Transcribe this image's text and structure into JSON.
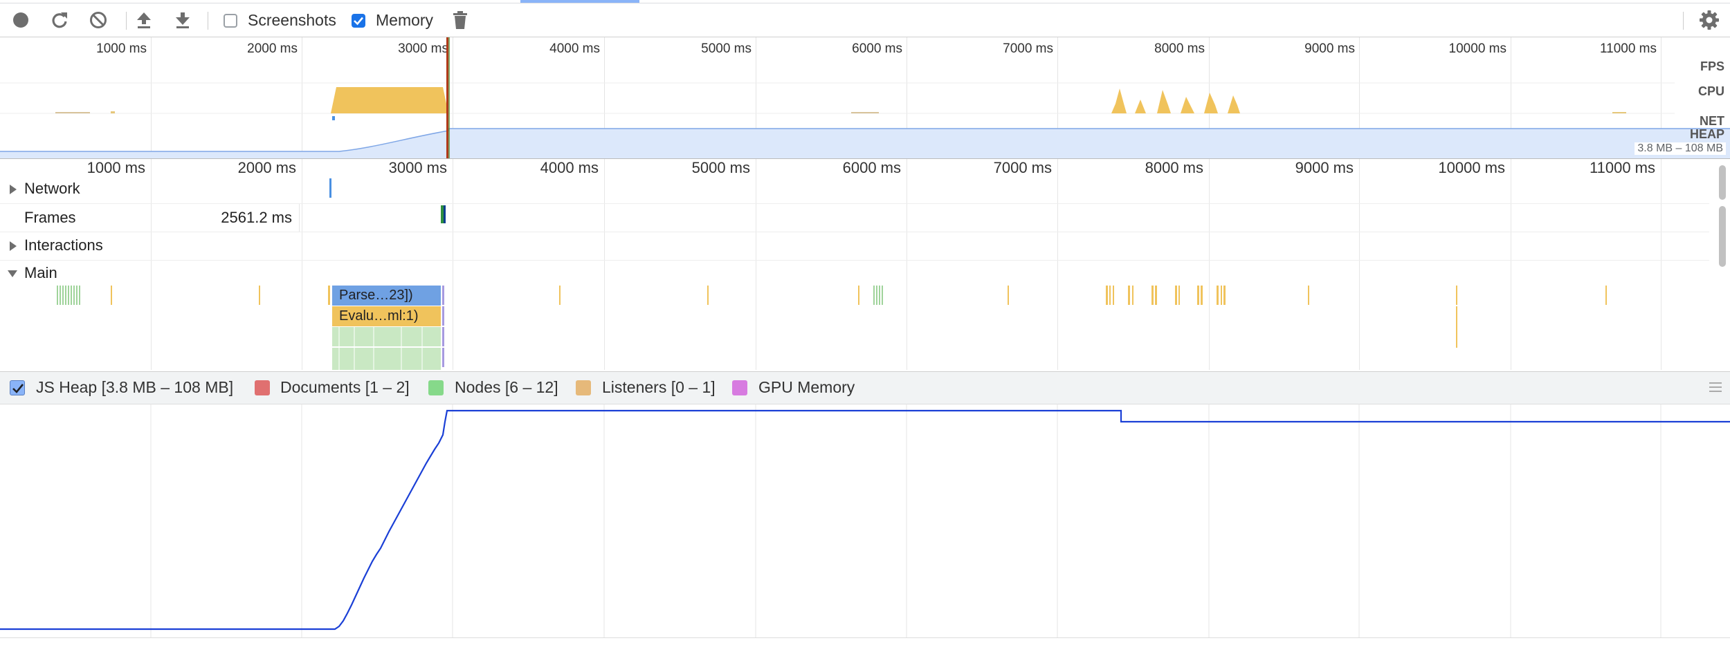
{
  "toolbar": {
    "record_icon": "record-icon",
    "reload_icon": "reload-icon",
    "clear_icon": "clear-icon",
    "load_icon": "upload-icon",
    "save_icon": "download-icon",
    "screenshots_label": "Screenshots",
    "screenshots_checked": false,
    "memory_label": "Memory",
    "memory_checked": true,
    "gc_icon": "trash-icon",
    "settings_icon": "gear-icon"
  },
  "overview": {
    "ticks": [
      "1000 ms",
      "2000 ms",
      "3000 ms",
      "4000 ms",
      "5000 ms",
      "6000 ms",
      "7000 ms",
      "8000 ms",
      "9000 ms",
      "10000 ms",
      "11000 ms"
    ],
    "lanes": {
      "fps": "FPS",
      "cpu": "CPU",
      "net": "NET",
      "heap": "HEAP"
    },
    "heap_range": "3.8 MB – 108 MB"
  },
  "timeline": {
    "ticks": [
      "1000 ms",
      "2000 ms",
      "3000 ms",
      "4000 ms",
      "5000 ms",
      "6000 ms",
      "7000 ms",
      "8000 ms",
      "9000 ms",
      "10000 ms",
      "11000 ms"
    ],
    "tracks": {
      "network": "Network",
      "frames": "Frames",
      "frame_duration": "2561.2 ms",
      "interactions": "Interactions",
      "main": "Main"
    },
    "main_events": {
      "parse": "Parse…23])",
      "evaluate": "Evalu…ml:1)"
    }
  },
  "counters": {
    "js_heap": {
      "label": "JS Heap [3.8 MB – 108 MB]",
      "color": "#1a73e8",
      "checked": true
    },
    "documents": {
      "label": "Documents [1 – 2]",
      "color": "#e07070"
    },
    "nodes": {
      "label": "Nodes [6 – 12]",
      "color": "#86d98a"
    },
    "listeners": {
      "label": "Listeners [0 – 1]",
      "color": "#e6b97a"
    },
    "gpu_memory": {
      "label": "GPU Memory",
      "color": "#d77be0"
    }
  },
  "colors": {
    "accent": "#1a73e8",
    "cpu_scripting": "#f0c35c",
    "heap_fill": "#dce8fb",
    "heap_line": "#1a3fd6",
    "current_time_marker": "#b03a1a"
  }
}
